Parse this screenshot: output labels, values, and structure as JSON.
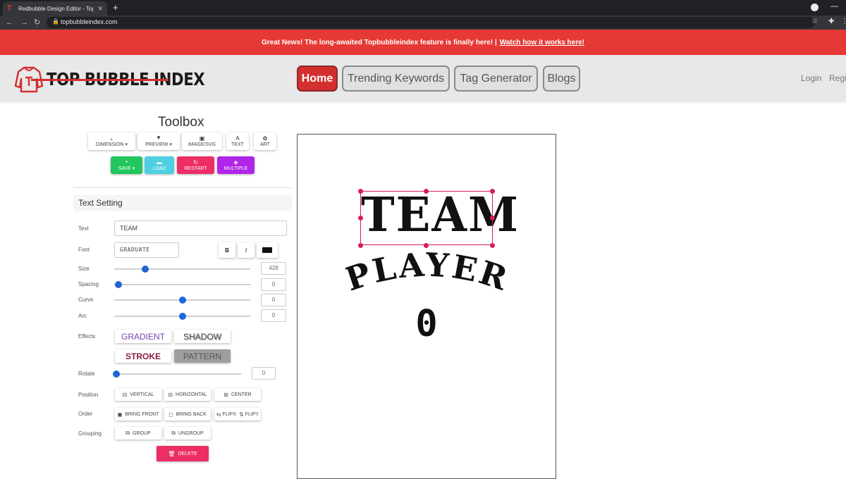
{
  "browser": {
    "tab_title": "Redbubble Design Editor - Topbu",
    "tab_close": "✕",
    "new_tab": "+",
    "url": "topbubbleindex.com",
    "minimize": "—"
  },
  "announcement": {
    "text": "Great News! The long-awaited Topbubbleindex feature is finally here! |",
    "link": "Watch how it works here!"
  },
  "header": {
    "logo_text": "TOP BUBBLE INDEX",
    "nav": [
      {
        "label": "Home"
      },
      {
        "label": "Trending Keywords"
      },
      {
        "label": "Tag Generator"
      },
      {
        "label": "Blogs"
      }
    ],
    "login": "Login",
    "register": "Regi"
  },
  "toolbox": {
    "title": "Toolbox",
    "row1": [
      {
        "label": "DIMENSION ▾",
        "icon": "crop-icon",
        "glyph": "⌞"
      },
      {
        "label": "PREVIEW ▾",
        "icon": "tshirt-icon",
        "glyph": "👕"
      },
      {
        "label": "IMAGE/SVG",
        "icon": "image-icon",
        "glyph": "▣"
      },
      {
        "label": "TEXT",
        "icon": "text-icon",
        "glyph": "A"
      },
      {
        "label": "ART",
        "icon": "palette-icon",
        "glyph": "✿"
      }
    ],
    "row2": [
      {
        "label": "SAVE ▾",
        "icon": "save-icon",
        "glyph": "▪"
      },
      {
        "label": "LOAD",
        "icon": "folder-icon",
        "glyph": "▬"
      },
      {
        "label": "RESTART",
        "icon": "refresh-icon",
        "glyph": "↻"
      },
      {
        "label": "MULTIPLE",
        "icon": "layers-icon",
        "glyph": "◈"
      }
    ]
  },
  "text_setting": {
    "title": "Text Setting",
    "labels": {
      "text": "Text",
      "font": "Font",
      "size": "Size",
      "spacing": "Spacing",
      "curve": "Curve",
      "arc": "Arc",
      "effects": "Effects",
      "rotate": "Rotate",
      "position": "Position",
      "order": "Order",
      "grouping": "Grouping"
    },
    "text_value": "TEAM",
    "font_value": "GRADUATE",
    "bold": "B",
    "italic": "I",
    "color": "#111111",
    "size": 428,
    "spacing": 0,
    "curve": 0,
    "arc": 0,
    "rotate": 0,
    "effects": [
      "GRADIENT",
      "SHADOW",
      "STROKE",
      "PATTERN"
    ],
    "position_buttons": [
      "VERTICAL",
      "HORIZONTAL",
      "CENTER"
    ],
    "order_buttons": [
      "BRING FRONT",
      "BRING BACK",
      "FLIPX",
      "FLIPY"
    ],
    "grouping_buttons": [
      "GROUP",
      "UNGROUP"
    ],
    "delete": "DELETE"
  },
  "canvas": {
    "line1": "TEAM",
    "line2": "PLAYER",
    "line3": "0"
  },
  "colors": {
    "brand_red": "#d32f2f",
    "announce_bg": "#e53935",
    "slider_blue": "#2166d6",
    "selection": "#d81b60"
  }
}
